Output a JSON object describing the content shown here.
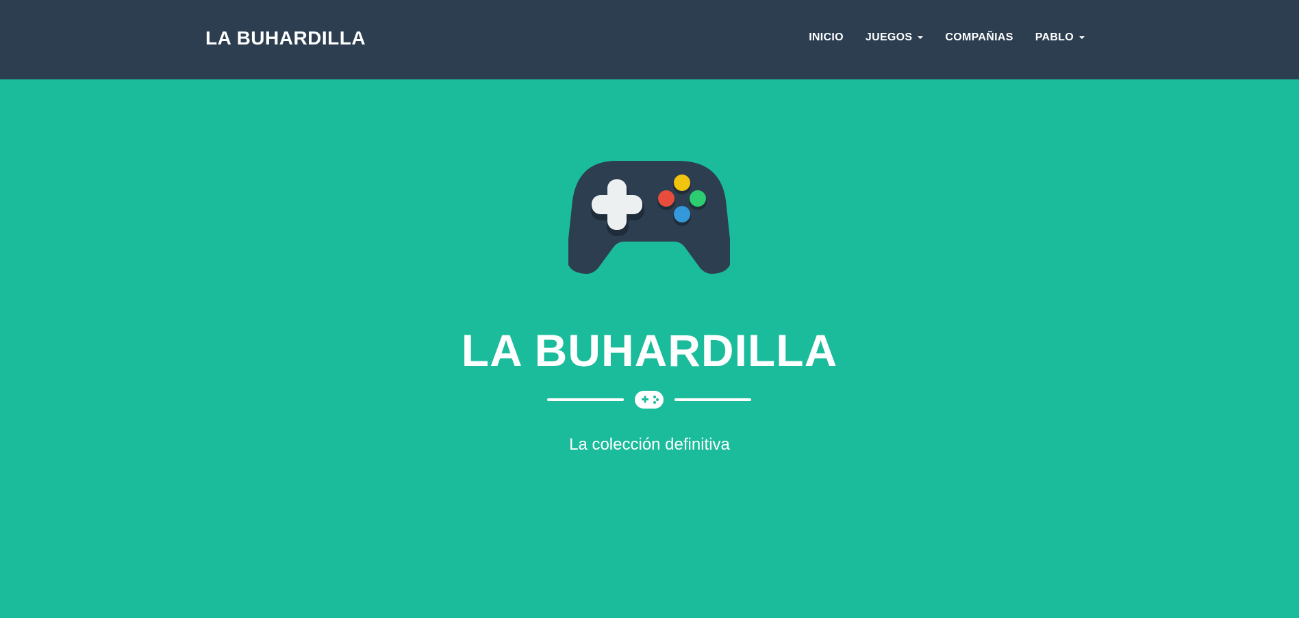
{
  "navbar": {
    "brand": "LA BUHARDILLA",
    "items": [
      {
        "label": "INICIO",
        "dropdown": false
      },
      {
        "label": "JUEGOS",
        "dropdown": true
      },
      {
        "label": "COMPAÑIAS",
        "dropdown": false
      },
      {
        "label": "PABLO",
        "dropdown": true
      }
    ]
  },
  "hero": {
    "icon": "gamepad-icon",
    "title": "LA BUHARDILLA",
    "divider_icon": "gamepad-icon",
    "subtitle": "La colección definitiva"
  },
  "colors": {
    "navbar_bg": "#2c3e50",
    "hero_bg": "#1abc9c",
    "text": "#ffffff",
    "button_yellow": "#f1c40f",
    "button_red": "#e74c3c",
    "button_green": "#2ecc71",
    "button_blue": "#3498db"
  }
}
